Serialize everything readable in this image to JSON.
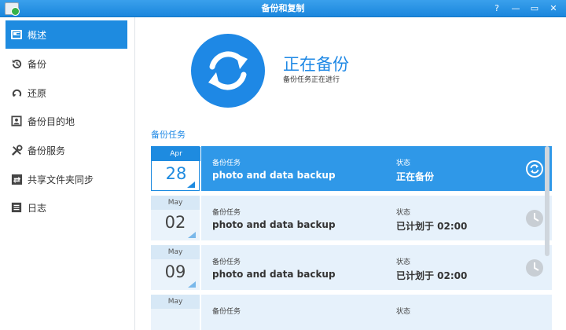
{
  "window": {
    "title": "备份和复制",
    "controls": [
      "?",
      "—",
      "▭",
      "✕"
    ]
  },
  "sidebar": {
    "items": [
      {
        "label": "概述",
        "icon": "overview-icon",
        "active": true
      },
      {
        "label": "备份",
        "icon": "clock-history-icon",
        "active": false
      },
      {
        "label": "还原",
        "icon": "restore-icon",
        "active": false
      },
      {
        "label": "备份目的地",
        "icon": "destination-icon",
        "active": false
      },
      {
        "label": "备份服务",
        "icon": "tools-icon",
        "active": false
      },
      {
        "label": "共享文件夹同步",
        "icon": "sync-folder-icon",
        "active": false
      },
      {
        "label": "日志",
        "icon": "log-icon",
        "active": false
      }
    ]
  },
  "status": {
    "title": "正在备份",
    "subtitle": "备份任务正在进行",
    "icon": "sync-icon",
    "color": "#1e88e5"
  },
  "tasks": {
    "section_title": "备份任务",
    "rows": [
      {
        "month": "Apr",
        "day": "28",
        "task_label": "备份任务",
        "task_name": "photo and data backup",
        "status_label": "状态",
        "status_value": "正在备份",
        "icon": "sync-icon",
        "active": true
      },
      {
        "month": "May",
        "day": "02",
        "task_label": "备份任务",
        "task_name": "photo and data backup",
        "status_label": "状态",
        "status_value": "已计划于 02:00",
        "icon": "clock-icon",
        "active": false
      },
      {
        "month": "May",
        "day": "09",
        "task_label": "备份任务",
        "task_name": "photo and data backup",
        "status_label": "状态",
        "status_value": "已计划于 02:00",
        "icon": "clock-icon",
        "active": false
      },
      {
        "month": "May",
        "day": "",
        "task_label": "备份任务",
        "task_name": "",
        "status_label": "状态",
        "status_value": "",
        "icon": "",
        "active": false
      }
    ]
  }
}
